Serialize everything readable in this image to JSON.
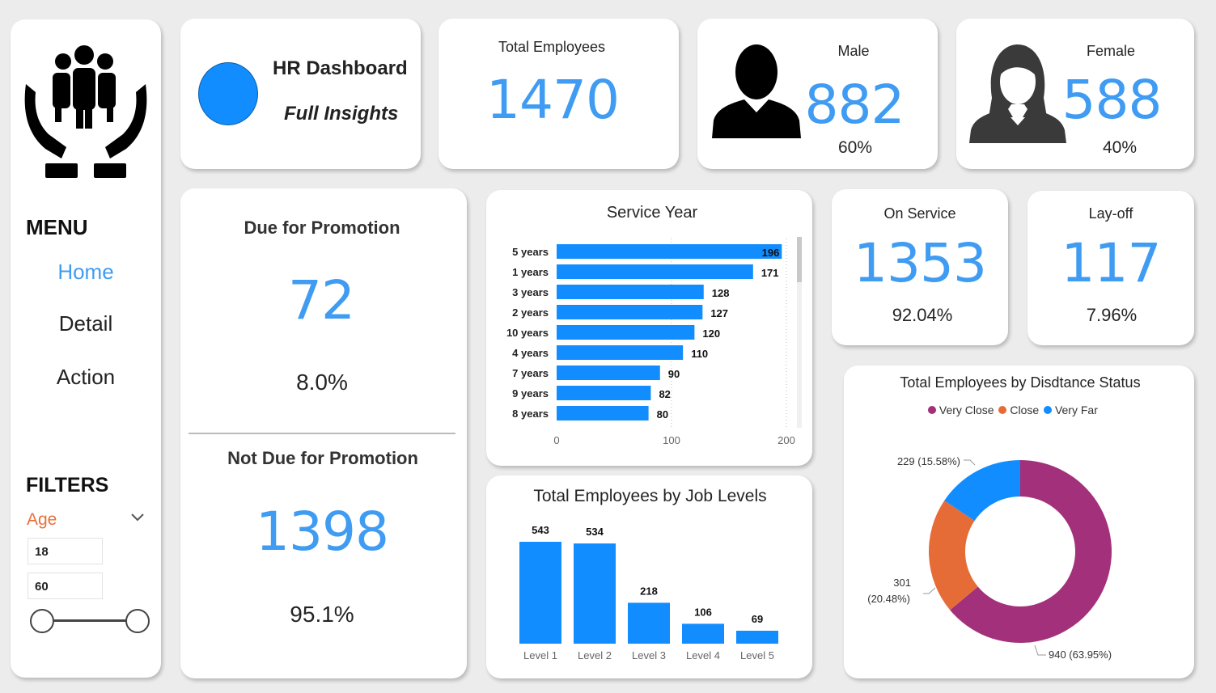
{
  "header": {
    "title": "HR Dashboard",
    "subtitle": "Full Insights"
  },
  "sidebar": {
    "menu_title": "MENU",
    "menu_items": [
      {
        "label": "Home",
        "active": true,
        "color": "#3f9cf2"
      },
      {
        "label": "Detail",
        "active": false
      },
      {
        "label": "Action",
        "active": false
      }
    ],
    "filters_title": "FILTERS",
    "filter": {
      "label": "Age",
      "label_color": "#e8703a",
      "min": "18",
      "max": "60"
    }
  },
  "kpis": {
    "total": {
      "label": "Total Employees",
      "value": "1470"
    },
    "male": {
      "label": "Male",
      "value": "882",
      "pct": "60%"
    },
    "female": {
      "label": "Female",
      "value": "588",
      "pct": "40%"
    },
    "on_service": {
      "label": "On Service",
      "value": "1353",
      "pct": "92.04%"
    },
    "layoff": {
      "label": "Lay-off",
      "value": "117",
      "pct": "7.96%"
    }
  },
  "promotion": {
    "due": {
      "label": "Due for Promotion",
      "value": "72",
      "pct": "8.0%"
    },
    "not_due": {
      "label": "Not Due for Promotion",
      "value": "1398",
      "pct": "95.1%"
    }
  },
  "colors": {
    "accent": "#3f9cf2",
    "bar": "#118dff",
    "very_close": "#a3307a",
    "close": "#e66c37",
    "very_far": "#118dff"
  },
  "chart_data": [
    {
      "type": "bar",
      "orientation": "horizontal",
      "title": "Service Year",
      "categories": [
        "5 years",
        "1 years",
        "3 years",
        "2 years",
        "10 years",
        "4 years",
        "7 years",
        "9 years",
        "8 years"
      ],
      "values": [
        196,
        171,
        128,
        127,
        120,
        110,
        90,
        82,
        80
      ],
      "xlim": [
        0,
        200
      ],
      "xticks": [
        "0",
        "100",
        "200"
      ],
      "grid": true
    },
    {
      "type": "bar",
      "title": "Total Employees by Job Levels",
      "categories": [
        "Level 1",
        "Level 2",
        "Level 3",
        "Level 4",
        "Level 5"
      ],
      "values": [
        543,
        534,
        218,
        106,
        69
      ],
      "ylim": [
        0,
        543
      ]
    },
    {
      "type": "pie",
      "donut": true,
      "title": "Total Employees by Disdtance Status",
      "legend_position": "top",
      "slices": [
        {
          "label": "Very Close",
          "value": 940,
          "data_label": "940 (63.95%)",
          "color": "#a3307a"
        },
        {
          "label": "Close",
          "value": 301,
          "data_label_line1": "301",
          "data_label_line2": "(20.48%)",
          "color": "#e66c37"
        },
        {
          "label": "Very Far",
          "value": 229,
          "data_label": "229 (15.58%)",
          "color": "#118dff"
        }
      ]
    }
  ]
}
